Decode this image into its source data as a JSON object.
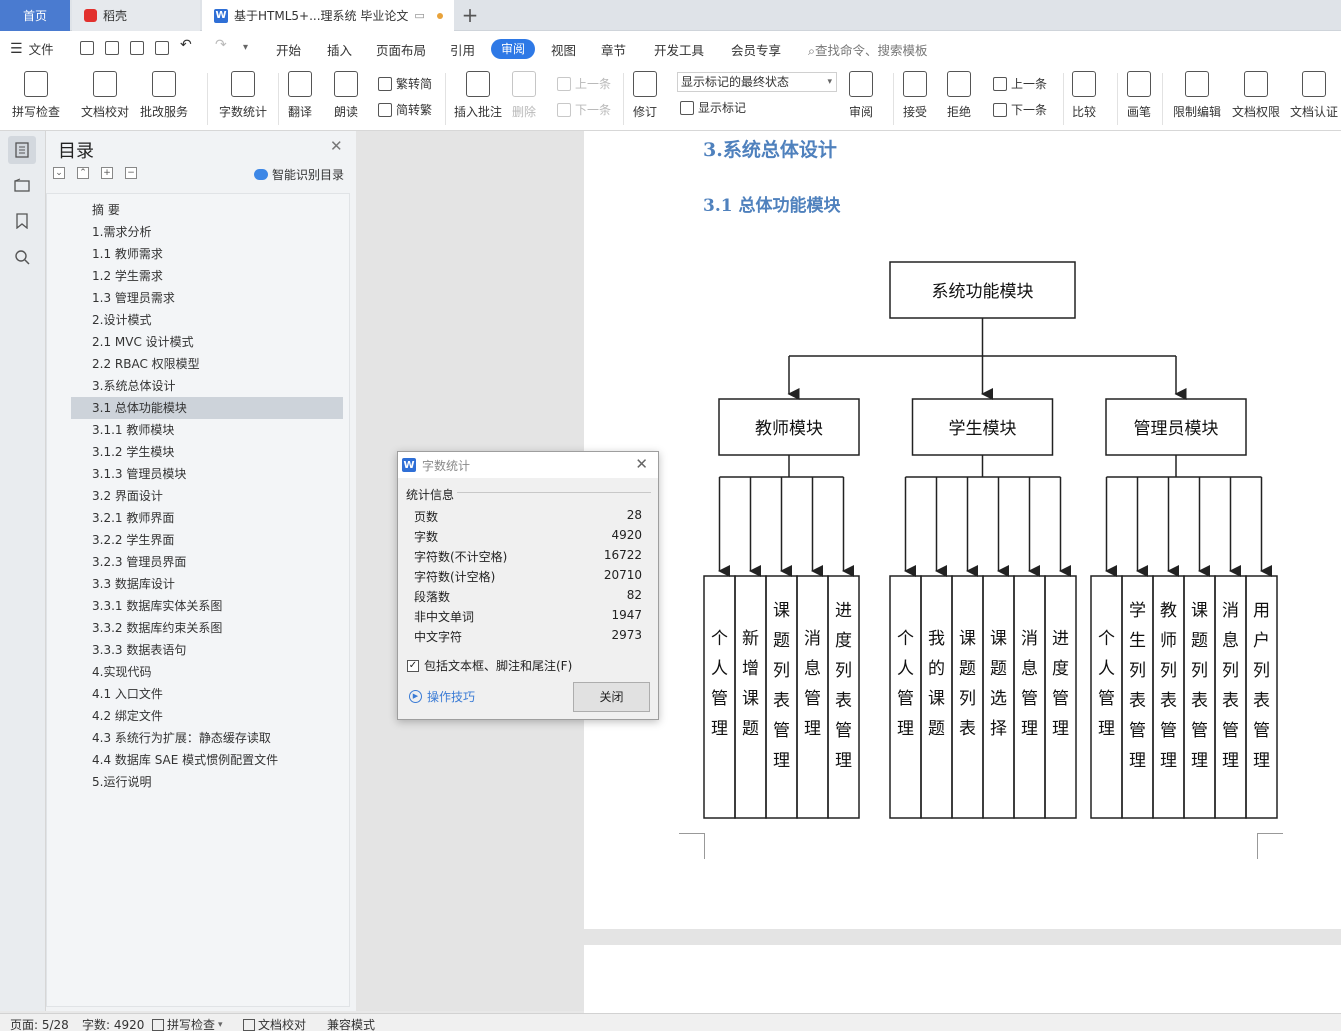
{
  "tabs": {
    "home": "首页",
    "daoke": "稻壳",
    "doc": "基于HTML5+...理系统 毕业论文"
  },
  "menu": {
    "file": "文件",
    "items": [
      "开始",
      "插入",
      "页面布局",
      "引用",
      "审阅",
      "视图",
      "章节",
      "开发工具",
      "会员专享"
    ],
    "active": "审阅",
    "search": "查找命令、搜索模板"
  },
  "ribbon": {
    "spell_check": "拼写检查",
    "doc_proof": "文档校对",
    "review_service": "批改服务",
    "word_count": "字数统计",
    "translate": "翻译",
    "read_aloud": "朗读",
    "to_traditional": "繁转简",
    "to_simplified": "简转繁",
    "insert_comment": "插入批注",
    "delete": "删除",
    "prev_comment": "上一条",
    "next_comment": "下一条",
    "track_changes": "修订",
    "markup_state": "显示标记的最终状态",
    "show_markup": "显示标记",
    "review": "审阅",
    "accept": "接受",
    "reject": "拒绝",
    "prev_change": "上一条",
    "next_change": "下一条",
    "compare": "比较",
    "pen": "画笔",
    "restrict_edit": "限制编辑",
    "doc_permission": "文档权限",
    "doc_auth": "文档认证"
  },
  "toc": {
    "title": "目录",
    "smart": "智能识别目录",
    "selected_index": 9,
    "items": [
      "摘  要",
      "1.需求分析",
      "1.1 教师需求",
      "1.2 学生需求",
      "1.3 管理员需求",
      "2.设计模式",
      "2.1 MVC 设计模式",
      "2.2 RBAC 权限模型",
      "3.系统总体设计",
      "3.1 总体功能模块",
      "3.1.1 教师模块",
      "3.1.2 学生模块",
      "3.1.3 管理员模块",
      "3.2 界面设计",
      "3.2.1 教师界面",
      "3.2.2 学生界面",
      "3.2.3 管理员界面",
      "3.3 数据库设计",
      "3.3.1 数据库实体关系图",
      "3.3.2 数据库约束关系图",
      "3.3.3 数据表语句",
      "4.实现代码",
      "4.1 入口文件",
      "4.2 绑定文件",
      "4.3 系统行为扩展：静态缓存读取",
      "4.4 数据库 SAE 模式惯例配置文件",
      "5.运行说明"
    ]
  },
  "document": {
    "heading1": "3.系统总体设计",
    "heading2": "3.1 总体功能模块",
    "diagram": {
      "root": "系统功能模块",
      "modules": [
        {
          "name": "教师模块",
          "leaves": [
            "个人管理",
            "新增课题",
            "课题列表管理",
            "消息管理",
            "进度列表管理"
          ]
        },
        {
          "name": "学生模块",
          "leaves": [
            "个人管理",
            "我的课题",
            "课题列表",
            "课题选择",
            "消息管理",
            "进度管理"
          ]
        },
        {
          "name": "管理员模块",
          "leaves": [
            "个人管理",
            "学生列表管理",
            "教师列表管理",
            "课题列表管理",
            "消息列表管理",
            "用户列表管理"
          ]
        }
      ]
    }
  },
  "dialog": {
    "title": "字数统计",
    "group": "统计信息",
    "stats": [
      {
        "label": "页数",
        "value": "28"
      },
      {
        "label": "字数",
        "value": "4920"
      },
      {
        "label": "字符数(不计空格)",
        "value": "16722"
      },
      {
        "label": "字符数(计空格)",
        "value": "20710"
      },
      {
        "label": "段落数",
        "value": "82"
      },
      {
        "label": "非中文单词",
        "value": "1947"
      },
      {
        "label": "中文字符",
        "value": "2973"
      }
    ],
    "checkbox": "包括文本框、脚注和尾注(F)",
    "checkbox_checked": true,
    "tips": "操作技巧",
    "close": "关闭"
  },
  "status": {
    "page": "页面: 5/28",
    "words": "字数: 4920",
    "spell": "拼写检查",
    "proof": "文档校对",
    "compat": "兼容模式"
  }
}
